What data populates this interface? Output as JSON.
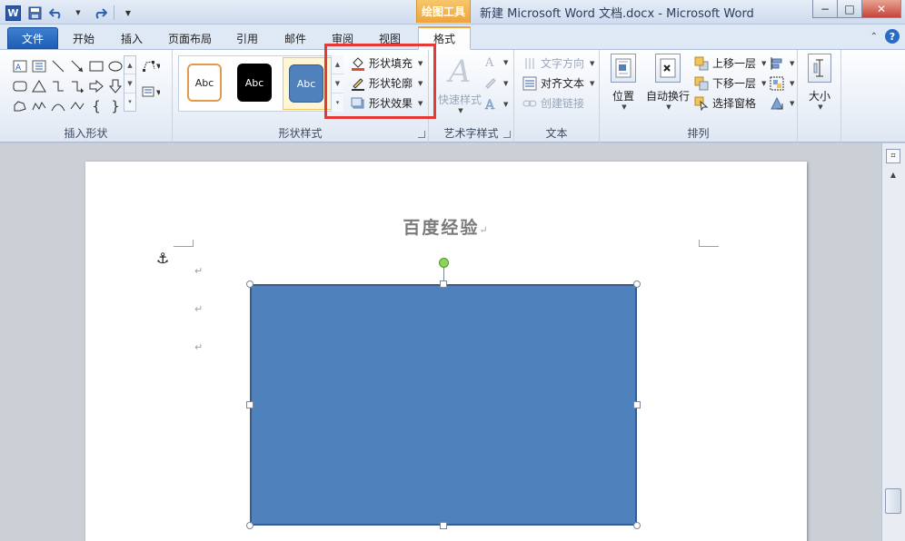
{
  "titlebar": {
    "app_letter": "W",
    "context_tool": "绘图工具",
    "title": "新建 Microsoft Word 文档.docx  -  Microsoft Word",
    "ctrl_min": "−",
    "ctrl_max": "□",
    "ctrl_close": "✕"
  },
  "tabs": {
    "file": "文件",
    "home": "开始",
    "insert": "插入",
    "layout": "页面布局",
    "references": "引用",
    "mailings": "邮件",
    "review": "审阅",
    "view": "视图",
    "format": "格式",
    "collapse": "⌃",
    "help": "?"
  },
  "ribbon": {
    "insert_shapes": {
      "label": "插入形状"
    },
    "shape_styles": {
      "label": "形状样式",
      "samples": [
        "Abc",
        "Abc",
        "Abc"
      ],
      "fill": "形状填充",
      "outline": "形状轮廓",
      "effects": "形状效果"
    },
    "wordart": {
      "label": "艺术字样式",
      "quick_styles": "快速样式"
    },
    "text": {
      "label": "文本",
      "direction": "文字方向",
      "align": "对齐文本",
      "link": "创建链接"
    },
    "arrange": {
      "label": "排列",
      "position": "位置",
      "wrap": "自动换行",
      "bring_forward": "上移一层",
      "send_backward": "下移一层",
      "selection_pane": "选择窗格"
    },
    "size": {
      "label": "大小"
    }
  },
  "document": {
    "title": "百度经验",
    "para_mark": "↵"
  },
  "colors": {
    "shape_fill": "#4f81bd",
    "shape_border": "#385d8a",
    "highlight": "#e53935",
    "context_tab": "#eea43a"
  }
}
